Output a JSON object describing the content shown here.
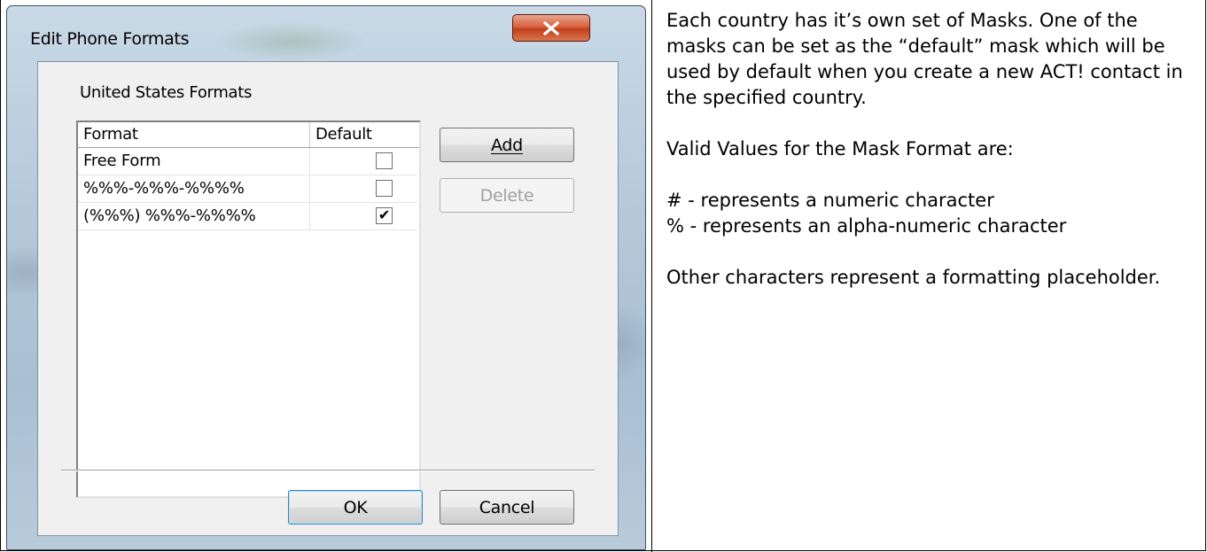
{
  "dialog": {
    "title": "Edit Phone Formats",
    "section_label": "United States Formats",
    "columns": [
      "Format",
      "Default"
    ],
    "rows": [
      {
        "format": "Free Form",
        "default": false
      },
      {
        "format": "%%%-%%%-%%%%",
        "default": false
      },
      {
        "format": "(%%%) %%%-%%%%",
        "default": true
      }
    ],
    "buttons": {
      "add": "Add",
      "delete": "Delete",
      "ok": "OK",
      "cancel": "Cancel"
    }
  },
  "notes": {
    "paragraph1": "Each country has it’s own set of Masks. One of the masks can be set as the “default” mask which will be used by default when you create a new ACT! contact in the specified country.",
    "paragraph2": "Valid Values for the Mask Format are:",
    "rule1": "# - represents a numeric character",
    "rule2": "% - represents an alpha-numeric character",
    "paragraph3": "Other characters represent a formatting placeholder."
  }
}
